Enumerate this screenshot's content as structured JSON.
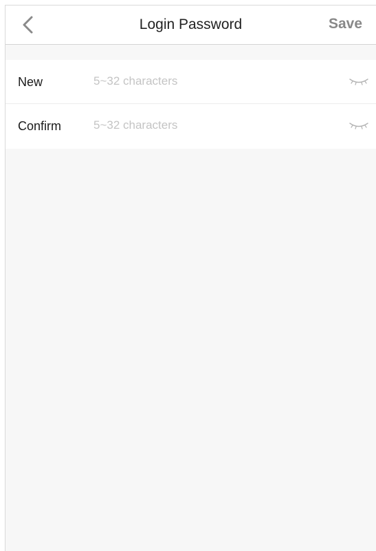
{
  "nav": {
    "title": "Login Password",
    "back_icon": "chevron-left-icon",
    "save_label": "Save"
  },
  "form": {
    "rows": [
      {
        "label": "New",
        "value": "",
        "placeholder": "5~32 characters",
        "toggle_icon": "eye-closed-icon"
      },
      {
        "label": "Confirm",
        "value": "",
        "placeholder": "5~32 characters",
        "toggle_icon": "eye-closed-icon"
      }
    ]
  },
  "colors": {
    "background": "#f7f7f7",
    "surface": "#ffffff",
    "placeholder": "#c4c4c4",
    "save_disabled": "#888888"
  }
}
